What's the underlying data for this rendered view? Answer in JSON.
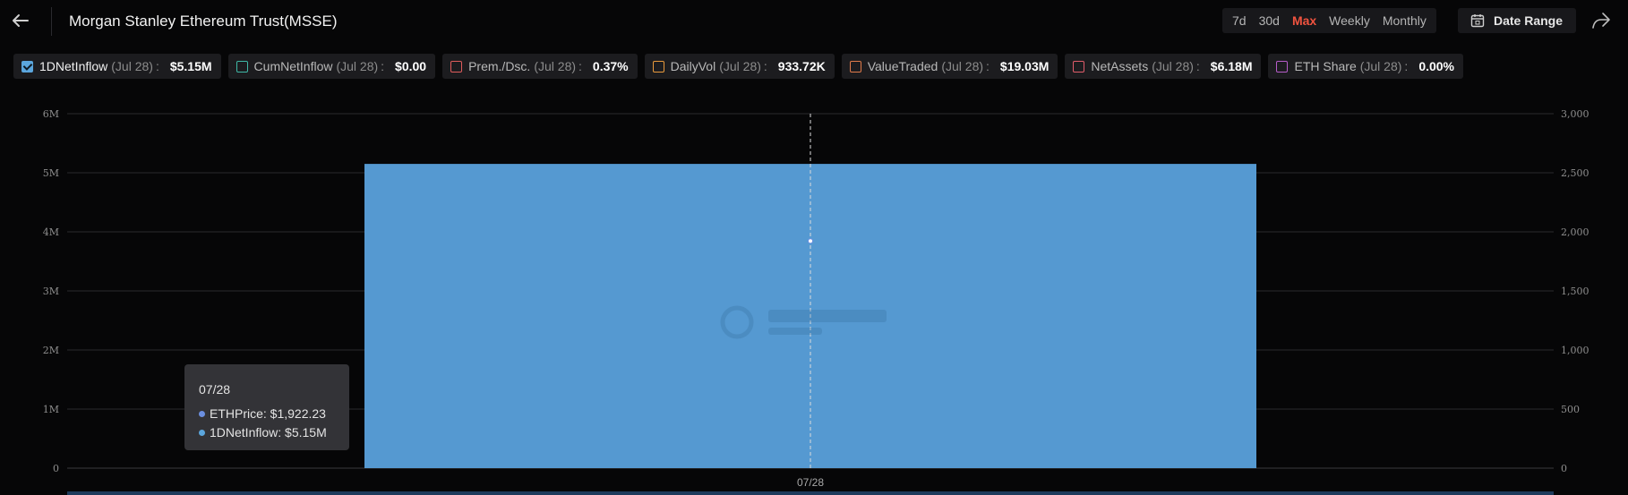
{
  "header": {
    "title": "Morgan Stanley Ethereum Trust(MSSE)",
    "ranges": [
      "7d",
      "30d",
      "Max",
      "Weekly",
      "Monthly"
    ],
    "active_range": "Max",
    "date_range_label": "Date Range"
  },
  "metrics": [
    {
      "name": "1DNetInflow",
      "date": "(Jul 28)",
      "colon": ":",
      "value": "$5.15M",
      "color": "#5ba6dd",
      "checked": true
    },
    {
      "name": "CumNetInflow",
      "date": "(Jul 28)",
      "colon": ":",
      "value": "$0.00",
      "color": "#3fb8a6",
      "checked": false
    },
    {
      "name": "Prem./Dsc.",
      "date": "(Jul 28)",
      "colon": ":",
      "value": "0.37%",
      "color": "#e05c5c",
      "checked": false
    },
    {
      "name": "DailyVol",
      "date": "(Jul 28)",
      "colon": ":",
      "value": "933.72K",
      "color": "#e89a3c",
      "checked": false
    },
    {
      "name": "ValueTraded",
      "date": "(Jul 28)",
      "colon": ":",
      "value": "$19.03M",
      "color": "#e07a4a",
      "checked": false
    },
    {
      "name": "NetAssets",
      "date": "(Jul 28)",
      "colon": ":",
      "value": "$6.18M",
      "color": "#e05c6a",
      "checked": false
    },
    {
      "name": "ETH Share",
      "date": "(Jul 28)",
      "colon": ":",
      "value": "0.00%",
      "color": "#b65cc9",
      "checked": false
    }
  ],
  "chart_data": {
    "type": "bar",
    "categories": [
      "07/28"
    ],
    "series": [
      {
        "name": "1DNetInflow",
        "values": [
          5150000
        ],
        "axis": "left",
        "color": "#5599d1"
      },
      {
        "name": "ETHPrice",
        "values": [
          1922.23
        ],
        "axis": "right",
        "color": "#6b8fe0"
      }
    ],
    "y_left": {
      "ticks": [
        "0",
        "1M",
        "2M",
        "3M",
        "4M",
        "5M",
        "6M"
      ],
      "range": [
        0,
        6000000
      ]
    },
    "y_right": {
      "ticks": [
        "0",
        "500",
        "1,000",
        "1,500",
        "2,000",
        "2,500",
        "3,000"
      ],
      "range": [
        0,
        3000
      ]
    },
    "grid": true
  },
  "tooltip": {
    "date": "07/28",
    "rows": [
      {
        "label": "ETHPrice: $1,922.23",
        "color": "#6b8fe0"
      },
      {
        "label": "1DNetInflow: $5.15M",
        "color": "#5ba6dd"
      }
    ]
  }
}
